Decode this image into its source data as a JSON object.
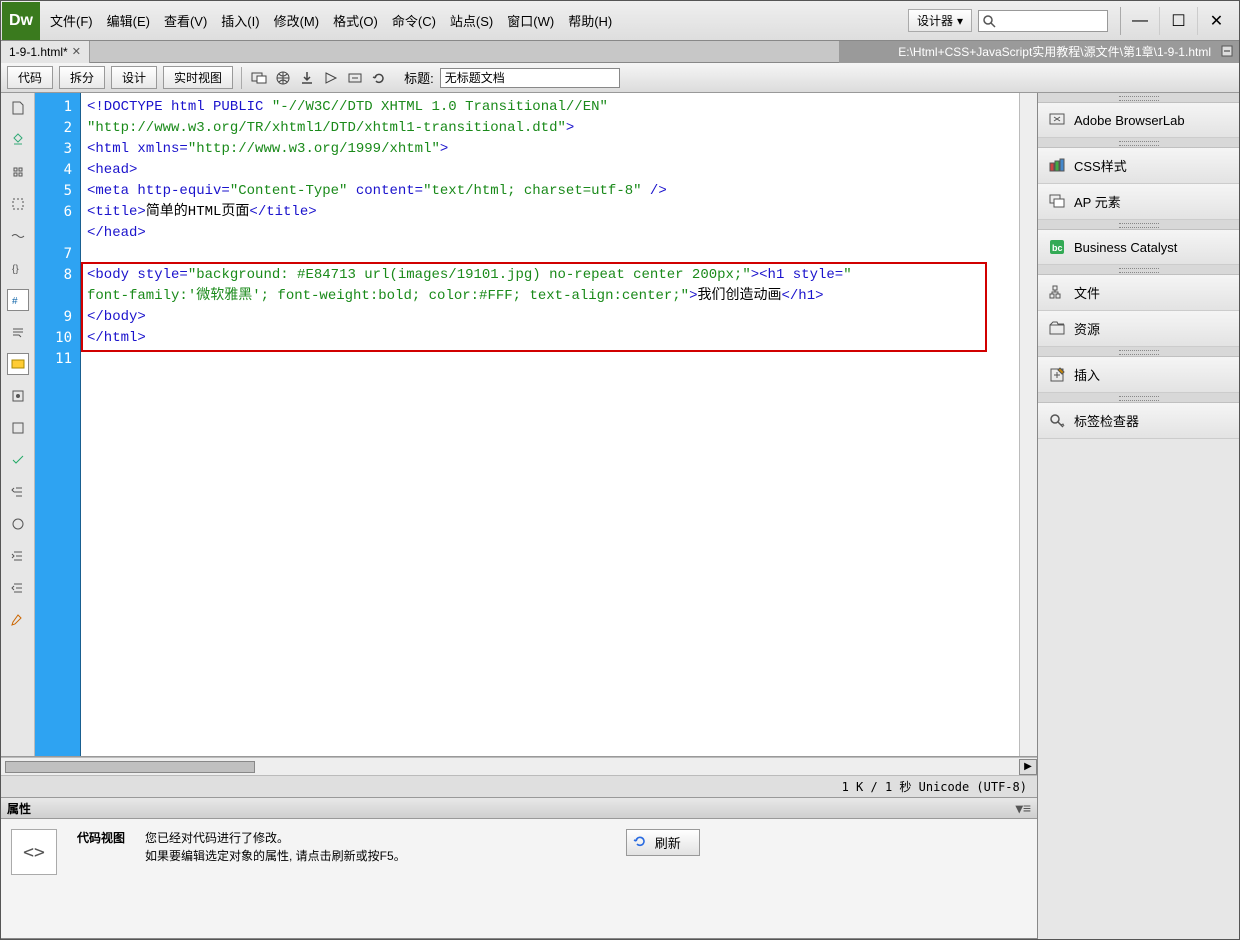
{
  "menu": {
    "file": "文件(F)",
    "edit": "编辑(E)",
    "view": "查看(V)",
    "insert": "插入(I)",
    "modify": "修改(M)",
    "format": "格式(O)",
    "command": "命令(C)",
    "site": "站点(S)",
    "window": "窗口(W)",
    "help": "帮助(H)"
  },
  "designer_label": "设计器",
  "tab": {
    "name": "1-9-1.html*"
  },
  "path": "E:\\Html+CSS+JavaScript实用教程\\源文件\\第1章\\1-9-1.html",
  "toolbar": {
    "code": "代码",
    "split": "拆分",
    "design": "设计",
    "live": "实时视图",
    "title_label": "标题:",
    "title_value": "无标题文档"
  },
  "gutter": [
    "1",
    "2",
    "3",
    "4",
    "5",
    "6",
    "7",
    "8",
    "9",
    "10",
    "11"
  ],
  "code": {
    "l1a": "<!DOCTYPE html PUBLIC ",
    "l1b": "\"-//W3C//DTD XHTML 1.0 Transitional//EN\"",
    "l2": "\"http://www.w3.org/TR/xhtml1/DTD/xhtml1-transitional.dtd\"",
    "l2b": ">",
    "l3a": "<html ",
    "l3b": "xmlns=",
    "l3c": "\"http://www.w3.org/1999/xhtml\"",
    "l3d": ">",
    "l4": "<head>",
    "l5a": "<meta ",
    "l5b": "http-equiv=",
    "l5c": "\"Content-Type\"",
    "l5d": " content=",
    "l5e": "\"text/html; charset=utf-8\"",
    "l5f": " />",
    "l6a": "<title>",
    "l6b": "简单的HTML页面",
    "l6c": "</title>",
    "l7": "</head>",
    "l8": "",
    "l9a": "<body ",
    "l9b": "style=",
    "l9c": "\"background: #E84713 url(images/19101.jpg) no-repeat center 200px;\"",
    "l9d": "><h1 ",
    "l9e": "style=",
    "l9f": "\"",
    "l10a": "font-family:'微软雅黑'; font-weight:bold; color:#FFF; text-align:center;\"",
    "l10b": ">",
    "l10c": "我们创造动画",
    "l10d": "</h1>",
    "l11": "</body>",
    "l12": "</html>"
  },
  "status": "1 K / 1 秒 Unicode (UTF-8)",
  "props": {
    "title": "属性",
    "view_label": "代码视图",
    "msg1": "您已经对代码进行了修改。",
    "msg2": "如果要编辑选定对象的属性, 请点击刷新或按F5。",
    "refresh": "刷新"
  },
  "panels": {
    "browserlab": "Adobe BrowserLab",
    "css": "CSS样式",
    "ap": "AP 元素",
    "bc": "Business Catalyst",
    "files": "文件",
    "assets": "资源",
    "insert": "插入",
    "tag": "标签检查器"
  }
}
